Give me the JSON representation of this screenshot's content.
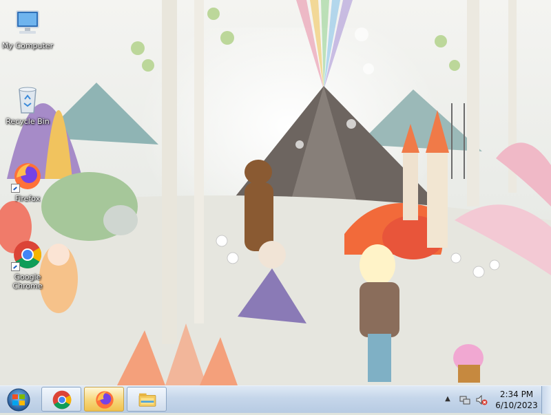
{
  "desktop": {
    "icons": [
      {
        "label": "My Computer"
      },
      {
        "label": "Recycle Bin"
      },
      {
        "label": "Firefox"
      },
      {
        "label": "Google Chrome"
      }
    ]
  },
  "taskbar": {
    "pinned": [
      {
        "icon": "chrome-icon"
      },
      {
        "icon": "firefox-icon"
      },
      {
        "icon": "file-explorer-icon"
      }
    ],
    "clock": {
      "time": "2:34 PM",
      "date": "6/10/2023"
    }
  }
}
